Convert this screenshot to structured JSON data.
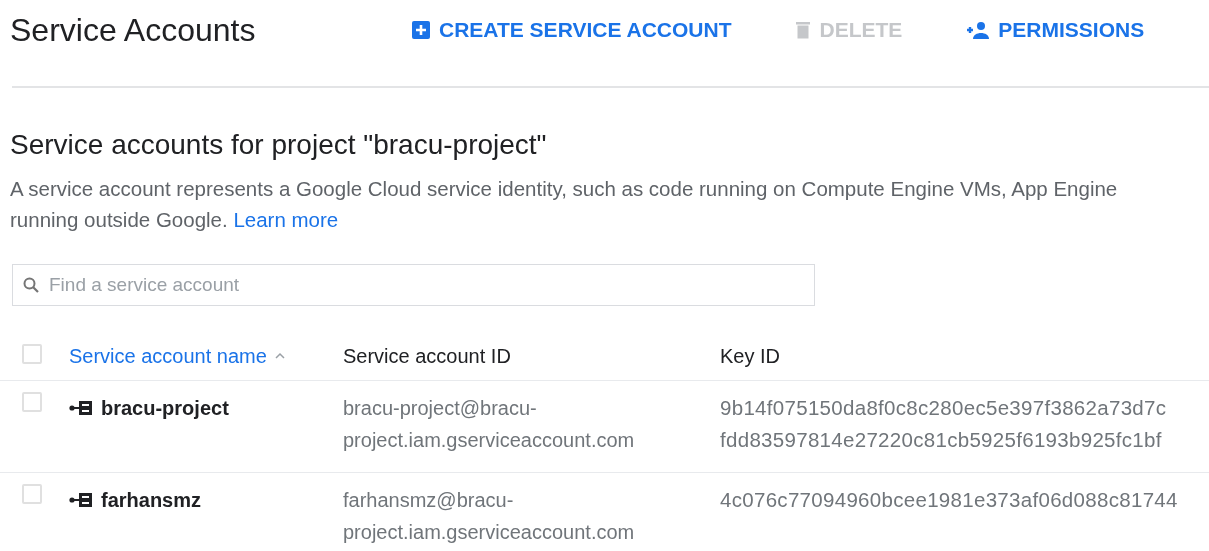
{
  "header": {
    "title": "Service Accounts",
    "actions": [
      {
        "kind": "create",
        "label": "CREATE SERVICE ACCOUNT",
        "disabled": false
      },
      {
        "kind": "delete",
        "label": "DELETE",
        "disabled": true
      },
      {
        "kind": "permissions",
        "label": "PERMISSIONS",
        "disabled": false
      }
    ]
  },
  "section": {
    "heading": "Service accounts for project \"bracu-project\"",
    "description": "A service account represents a Google Cloud service identity, such as code running on Compute Engine VMs, App Engine",
    "description_2": "running outside Google.",
    "link": "Learn more"
  },
  "search": {
    "placeholder": "Find a service account"
  },
  "table": {
    "select_all": {
      "checked": false
    },
    "columns": [
      {
        "label": "Service account name",
        "sorted": true
      },
      {
        "label": "Service account ID",
        "sorted": false
      },
      {
        "label": "Key ID",
        "sorted": false
      }
    ],
    "rows": [
      {
        "checked": false,
        "name": "bracu-project",
        "id": [
          "bracu-project@bracu-",
          "project.iam.gserviceaccount.com"
        ],
        "keys": [
          "9b14f075150da8f0c8c280ec5e397f3862a73d7c",
          "fdd83597814e27220c81cb5925f6193b925fc1bf"
        ]
      },
      {
        "checked": false,
        "name": "farhansmz",
        "id": [
          "farhansmz@bracu-",
          "project.iam.gserviceaccount.com"
        ],
        "keys": [
          "4c076c77094960bcee1981e373af06d088c81744"
        ]
      }
    ]
  }
}
